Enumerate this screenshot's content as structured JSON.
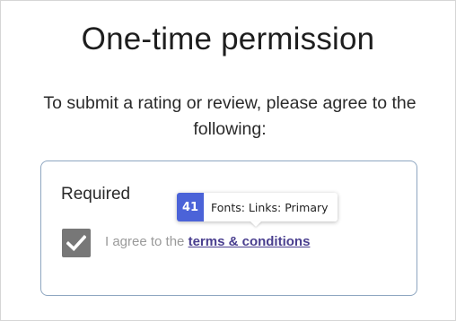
{
  "dialog": {
    "title": "One-time permission",
    "subtitle": "To submit a rating or review, please agree to the following:",
    "required_heading": "Required",
    "agree_prefix": "I agree to the ",
    "terms_link": "terms & conditions",
    "checkbox_checked": true
  },
  "tooltip": {
    "badge": "41",
    "label": "Fonts: Links: Primary"
  },
  "colors": {
    "link": "#4a3f8f",
    "checkbox": "#777777",
    "badge": "#4b63d8",
    "card_border": "#8ea6c0"
  },
  "icons": {
    "checkbox": "checkmark-icon"
  }
}
